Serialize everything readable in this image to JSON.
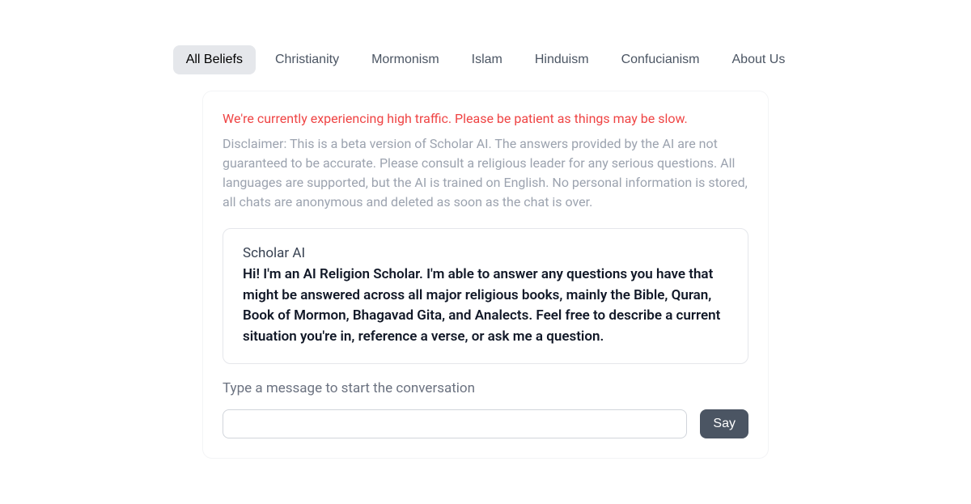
{
  "tabs": {
    "items": [
      {
        "label": "All Beliefs",
        "active": true
      },
      {
        "label": "Christianity",
        "active": false
      },
      {
        "label": "Mormonism",
        "active": false
      },
      {
        "label": "Islam",
        "active": false
      },
      {
        "label": "Hinduism",
        "active": false
      },
      {
        "label": "Confucianism",
        "active": false
      },
      {
        "label": "About Us",
        "active": false
      }
    ]
  },
  "alert": {
    "text": "We're currently experiencing high traffic. Please be patient as things may be slow."
  },
  "disclaimer": {
    "text": "Disclaimer: This is a beta version of Scholar AI. The answers provided by the AI are not guaranteed to be accurate. Please consult a religious leader for any serious questions. All languages are supported, but the AI is trained on English. No personal information is stored, all chats are anonymous and deleted as soon as the chat is over."
  },
  "message": {
    "sender": "Scholar AI",
    "body": "Hi! I'm an AI Religion Scholar. I'm able to answer any questions you have that might be answered across all major religious books, mainly the Bible, Quran, Book of Mormon, Bhagavad Gita, and Analects. Feel free to describe a current situation you're in, reference a verse, or ask me a question."
  },
  "prompt": {
    "text": "Type a message to start the conversation"
  },
  "input": {
    "value": "",
    "placeholder": ""
  },
  "button": {
    "say": "Say"
  }
}
